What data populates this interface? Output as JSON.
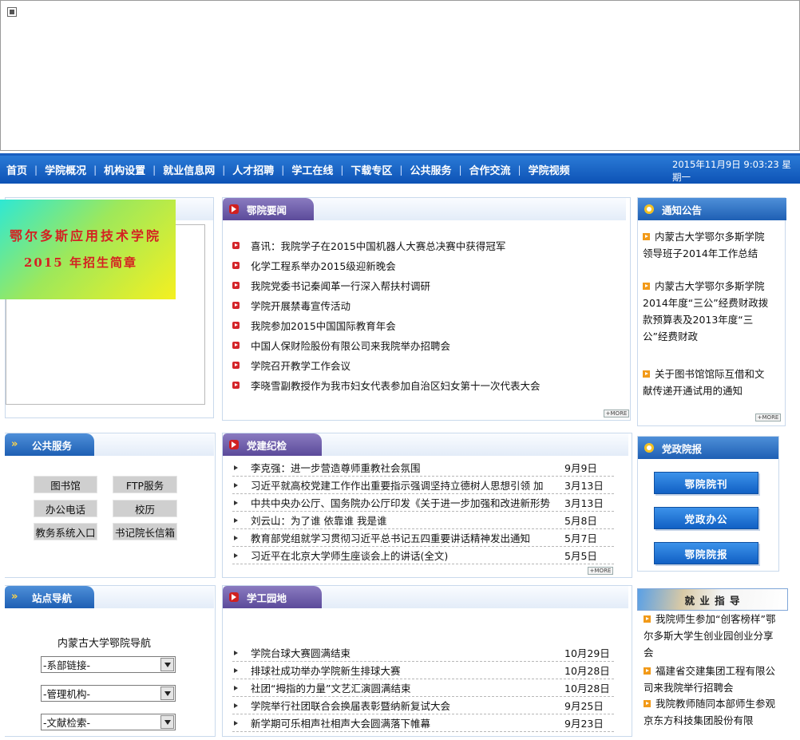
{
  "nav": {
    "items": [
      "首页",
      "学院概况",
      "机构设置",
      "就业信息网",
      "人才招聘",
      "学工在线",
      "下载专区",
      "公共服务",
      "合作交流",
      "学院视频"
    ],
    "datetime": "2015年11月9日 9:03:23 星期一"
  },
  "promo": {
    "line1": "鄂尔多斯应用技术学院",
    "line2": "2015 年招生简章"
  },
  "news": {
    "title": "鄂院要闻",
    "items": [
      "喜讯：我院学子在2015中国机器人大赛总决赛中获得冠军",
      "化学工程系举办2015级迎新晚会",
      "我院党委书记秦闻革一行深入帮扶村调研",
      "学院开展禁毒宣传活动",
      "我院参加2015中国国际教育年会",
      "中国人保财险股份有限公司来我院举办招聘会",
      "学院召开教学工作会议",
      "李晓雪副教授作为我市妇女代表参加自治区妇女第十一次代表大会"
    ],
    "more": "MORE"
  },
  "notice": {
    "title": "通知公告",
    "items": [
      "内蒙古大学鄂尔多斯学院领导班子2014年工作总结",
      "内蒙古大学鄂尔多斯学院2014年度“三公”经费财政拨款预算表及2013年度“三公”经费财政",
      "关于图书馆馆际互借和文献传递开通试用的通知"
    ],
    "more": "MORE"
  },
  "public": {
    "title": "公共服务",
    "buttons": [
      "图书馆",
      "FTP服务",
      "办公电话",
      "校历",
      "教务系统入口",
      "书记院长信箱"
    ]
  },
  "party": {
    "title": "党建纪检",
    "rows": [
      {
        "title": "李克强：进一步营造尊师重教社会氛围",
        "date": "9月9日"
      },
      {
        "title": "习近平就高校党建工作作出重要指示强调坚持立德树人思想引领 加",
        "date": "3月13日"
      },
      {
        "title": "中共中央办公厅、国务院办公厅印发《关于进一步加强和改进新形势",
        "date": "3月13日"
      },
      {
        "title": "刘云山：为了谁 依靠谁 我是谁",
        "date": "5月8日"
      },
      {
        "title": "教育部党组就学习贯彻习近平总书记五四重要讲话精神发出通知",
        "date": "5月7日"
      },
      {
        "title": "习近平在北京大学师生座谈会上的讲话(全文)",
        "date": "5月5日"
      }
    ],
    "more": "MORE"
  },
  "govnews": {
    "title": "党政院报",
    "buttons": [
      "鄂院院刊",
      "党政办公",
      "鄂院院报"
    ]
  },
  "sitenav": {
    "title": "站点导航",
    "heading": "内蒙古大学鄂院导航",
    "selects": [
      "-系部链接-",
      "-管理机构-",
      "-文献检索-"
    ]
  },
  "student": {
    "title": "学工园地",
    "rows": [
      {
        "title": "学院台球大赛圆满结束",
        "date": "10月29日"
      },
      {
        "title": "排球社成功举办学院新生排球大赛",
        "date": "10月28日"
      },
      {
        "title": "社团“拇指的力量”文艺汇演圆满结束",
        "date": "10月28日"
      },
      {
        "title": "学院举行社团联合会换届表彰暨纳新复试大会",
        "date": "9月25日"
      },
      {
        "title": "新学期可乐相声社相声大会圆满落下帷幕",
        "date": "9月23日"
      }
    ]
  },
  "jobs": {
    "title": "就 业 指 导",
    "items": [
      "我院师生参加“创客榜样”鄂尔多斯大学生创业园创业分享会",
      "福建省交建集团工程有限公司来我院举行招聘会",
      "我院教师随同本部师生参观京东方科技集团股份有限"
    ]
  },
  "colors": {
    "nav": "#0d52b5",
    "tabBlue": "#1e5fb4",
    "tabPurple": "#5b4a9a",
    "bullet": "#d4252a",
    "orange": "#f29a19"
  }
}
